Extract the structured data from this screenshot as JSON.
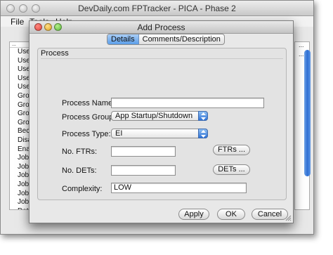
{
  "main_window": {
    "title": "DevDaily.com FPTracker - PICA - Phase 2",
    "menus": [
      "File",
      "Tools",
      "Help"
    ],
    "list_header": "...",
    "list_rows": [
      "Use",
      "Use",
      "Use",
      "Use",
      "Use",
      "Gro",
      "Gro",
      "Gro",
      "Gro",
      "Bec",
      "Disa",
      "Ena",
      "Job",
      "Job",
      "Job",
      "Job",
      "Job",
      "Job",
      "Dat",
      "Dat"
    ],
    "right_marks": [
      "...",
      "..."
    ]
  },
  "dialog": {
    "title": "Add Process",
    "tabs": [
      {
        "label": "Details",
        "selected": true
      },
      {
        "label": "Comments/Description",
        "selected": false
      }
    ],
    "group_label": "Process",
    "fields": {
      "process_name": {
        "label": "Process Name:",
        "value": ""
      },
      "process_group": {
        "label": "Process Group:",
        "value": "App Startup/Shutdown"
      },
      "process_type": {
        "label": "Process Type:",
        "value": "EI"
      },
      "no_ftrs": {
        "label": "No. FTRs:",
        "value": "",
        "button": "FTRs ..."
      },
      "no_dets": {
        "label": "No. DETs:",
        "value": "",
        "button": "DETs ..."
      },
      "complexity": {
        "label": "Complexity:",
        "value": "LOW"
      }
    },
    "buttons": {
      "apply": "Apply",
      "ok": "OK",
      "cancel": "Cancel"
    }
  },
  "colors": {
    "close": "#e0443e",
    "minimize": "#dea123",
    "zoom": "#5bb83b",
    "accent": "#3d7fdf"
  }
}
